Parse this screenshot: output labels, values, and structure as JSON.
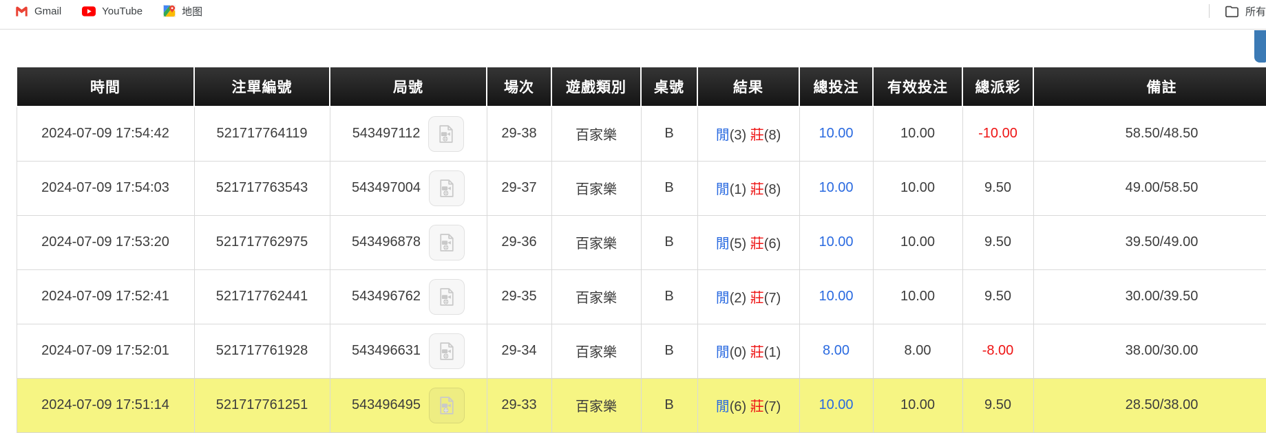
{
  "browser": {
    "bookmarks": [
      {
        "label": "Gmail",
        "icon": "gmail-icon"
      },
      {
        "label": "YouTube",
        "icon": "youtube-icon"
      },
      {
        "label": "地图",
        "icon": "maps-icon"
      }
    ],
    "bookmarks_right": {
      "label": "所有",
      "icon": "folder-icon"
    }
  },
  "colors": {
    "accent_blue": "#2a6ae0",
    "negative_red": "#ee1414",
    "highlight_yellow": "#f6f583",
    "header_bg": "#1e1e1e",
    "scrollbar_blue": "#3b7ab5"
  },
  "table": {
    "columns": [
      "時間",
      "注單編號",
      "局號",
      "場次",
      "遊戲類別",
      "桌號",
      "結果",
      "總投注",
      "有效投注",
      "總派彩",
      "備註"
    ],
    "rows": [
      {
        "time": "2024-07-09 17:54:42",
        "bet_id": "521717764119",
        "round_id": "543497112",
        "session": "29-38",
        "game": "百家樂",
        "table_no": "B",
        "player_label": "閒",
        "player_score": "(3)",
        "banker_label": "莊",
        "banker_score": "(8)",
        "total_bet": "10.00",
        "valid_bet": "10.00",
        "payout": "-10.00",
        "remark": "58.50/48.50",
        "highlighted": false
      },
      {
        "time": "2024-07-09 17:54:03",
        "bet_id": "521717763543",
        "round_id": "543497004",
        "session": "29-37",
        "game": "百家樂",
        "table_no": "B",
        "player_label": "閒",
        "player_score": "(1)",
        "banker_label": "莊",
        "banker_score": "(8)",
        "total_bet": "10.00",
        "valid_bet": "10.00",
        "payout": "9.50",
        "remark": "49.00/58.50",
        "highlighted": false
      },
      {
        "time": "2024-07-09 17:53:20",
        "bet_id": "521717762975",
        "round_id": "543496878",
        "session": "29-36",
        "game": "百家樂",
        "table_no": "B",
        "player_label": "閒",
        "player_score": "(5)",
        "banker_label": "莊",
        "banker_score": "(6)",
        "total_bet": "10.00",
        "valid_bet": "10.00",
        "payout": "9.50",
        "remark": "39.50/49.00",
        "highlighted": false
      },
      {
        "time": "2024-07-09 17:52:41",
        "bet_id": "521717762441",
        "round_id": "543496762",
        "session": "29-35",
        "game": "百家樂",
        "table_no": "B",
        "player_label": "閒",
        "player_score": "(2)",
        "banker_label": "莊",
        "banker_score": "(7)",
        "total_bet": "10.00",
        "valid_bet": "10.00",
        "payout": "9.50",
        "remark": "30.00/39.50",
        "highlighted": false
      },
      {
        "time": "2024-07-09 17:52:01",
        "bet_id": "521717761928",
        "round_id": "543496631",
        "session": "29-34",
        "game": "百家樂",
        "table_no": "B",
        "player_label": "閒",
        "player_score": "(0)",
        "banker_label": "莊",
        "banker_score": "(1)",
        "total_bet": "8.00",
        "valid_bet": "8.00",
        "payout": "-8.00",
        "remark": "38.00/30.00",
        "highlighted": false
      },
      {
        "time": "2024-07-09 17:51:14",
        "bet_id": "521717761251",
        "round_id": "543496495",
        "session": "29-33",
        "game": "百家樂",
        "table_no": "B",
        "player_label": "閒",
        "player_score": "(6)",
        "banker_label": "莊",
        "banker_score": "(7)",
        "total_bet": "10.00",
        "valid_bet": "10.00",
        "payout": "9.50",
        "remark": "28.50/38.00",
        "highlighted": true
      }
    ]
  }
}
